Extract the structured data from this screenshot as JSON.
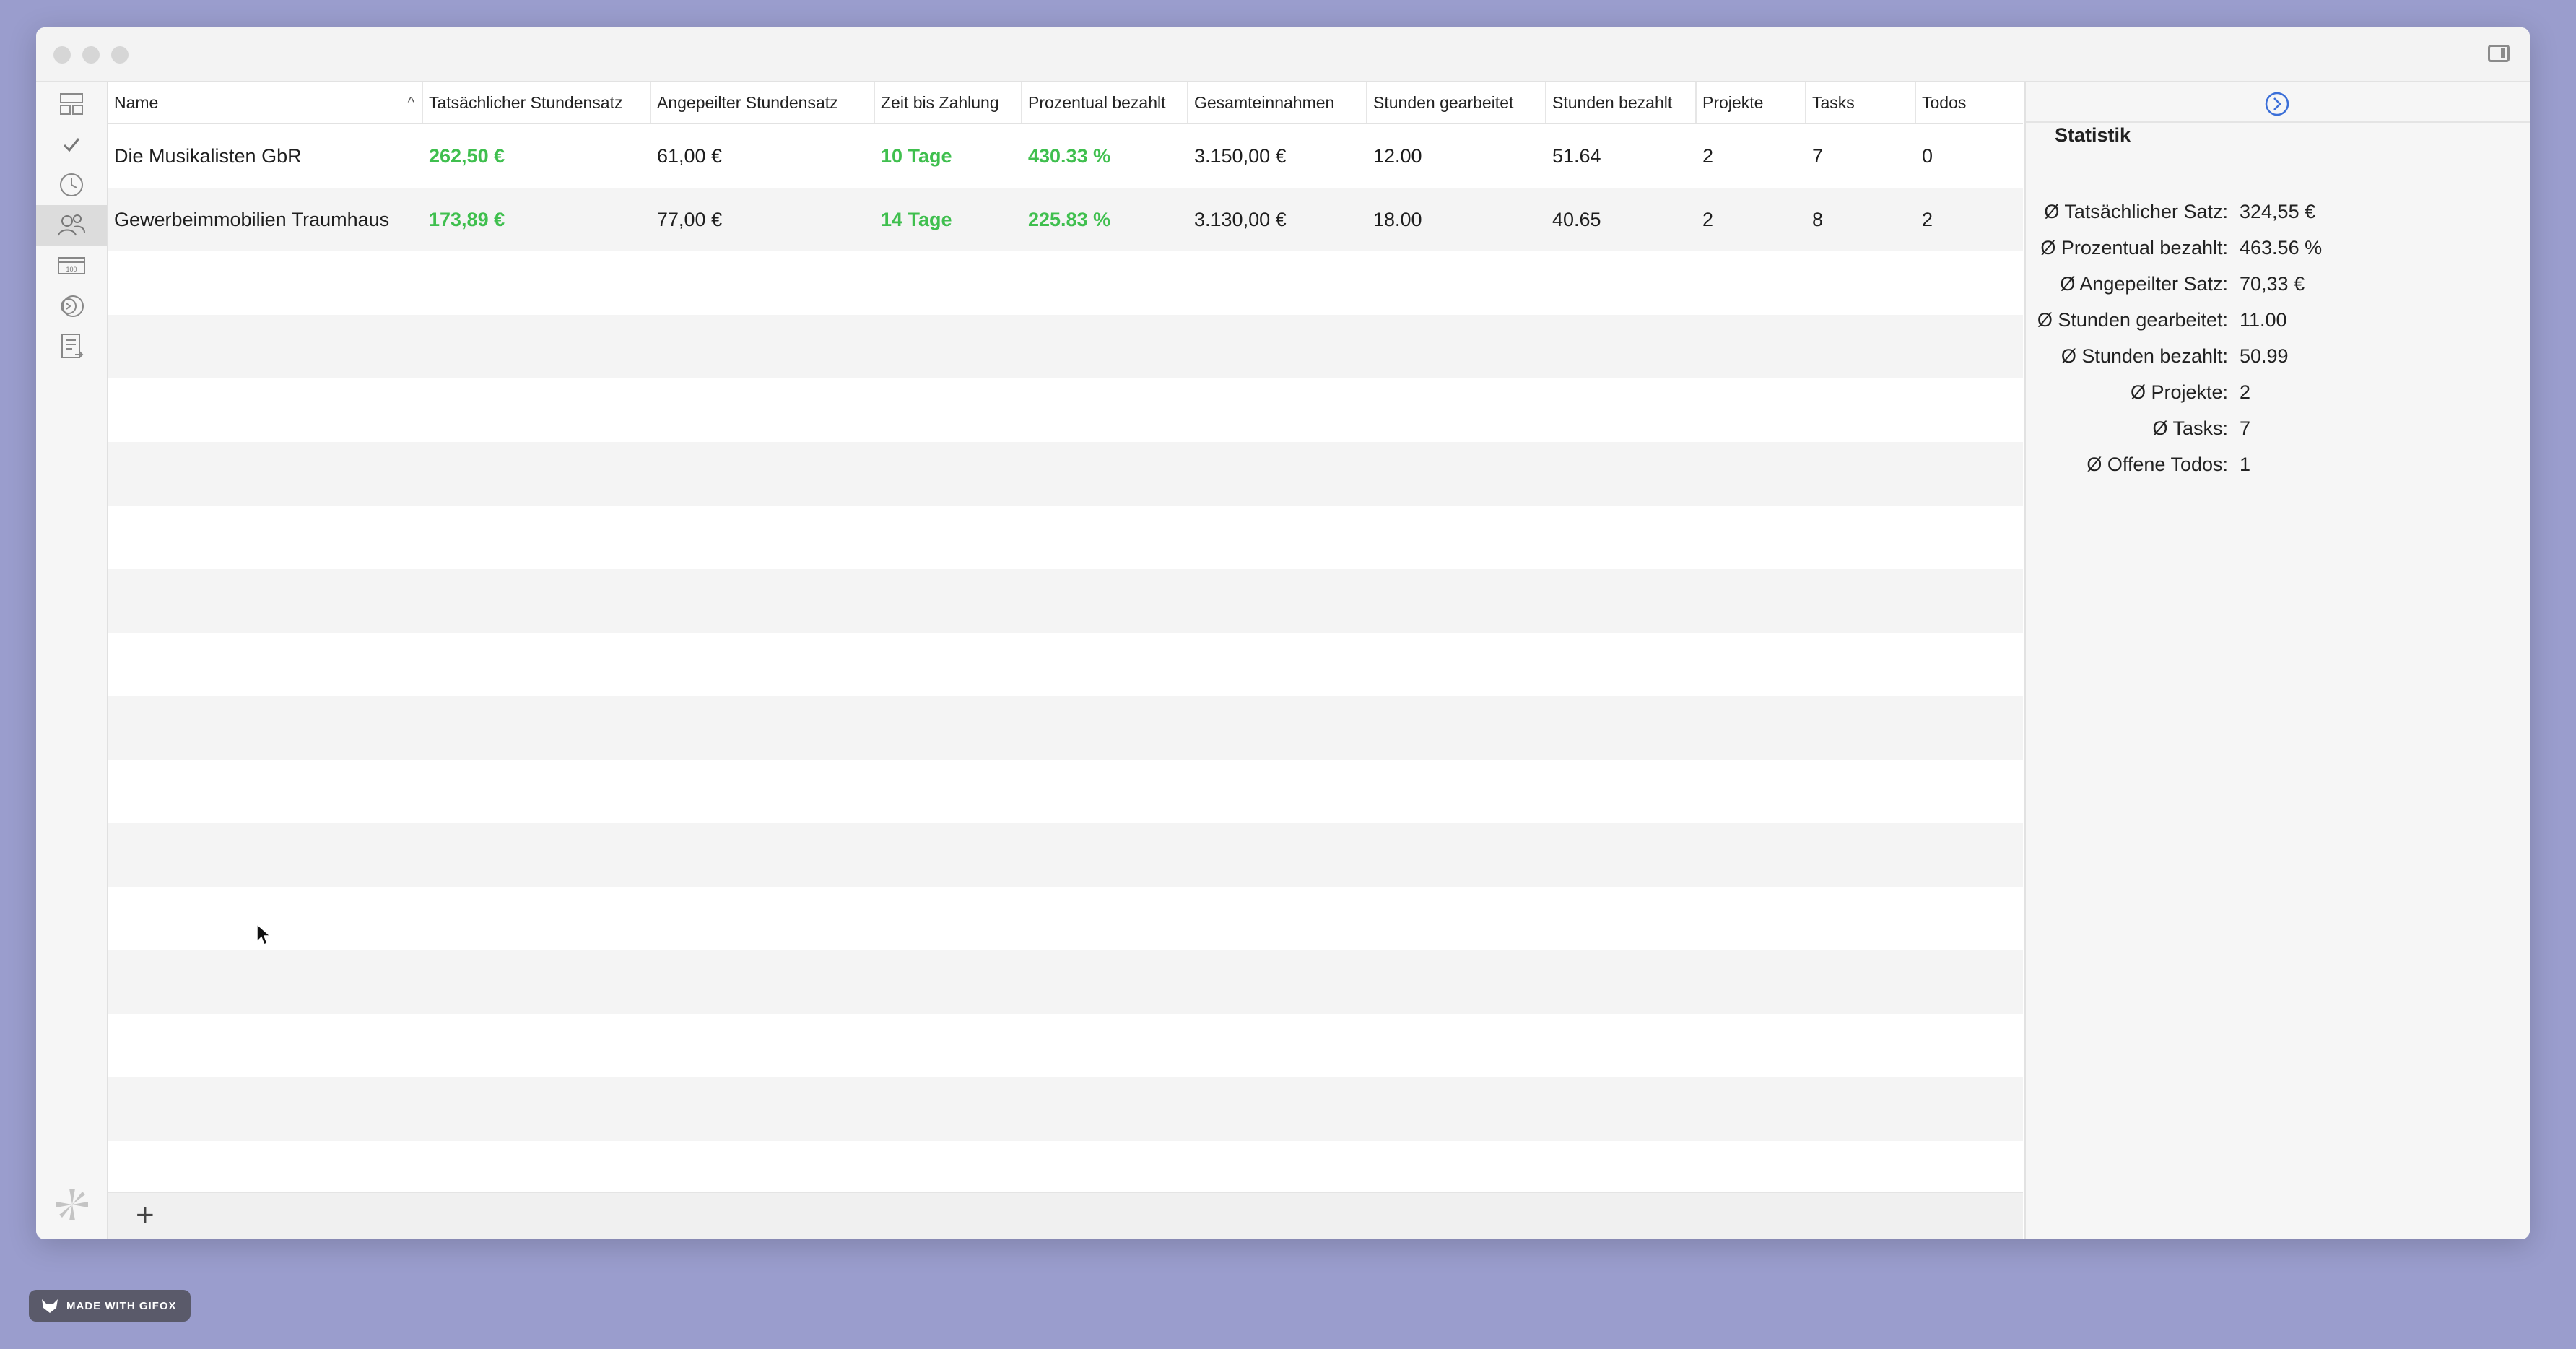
{
  "window": {
    "toolbar_icons": [
      "sidebar-toggle-icon"
    ]
  },
  "iconbar": {
    "items": [
      {
        "icon": "dashboard-icon",
        "active": false
      },
      {
        "icon": "checkmark-icon",
        "active": false
      },
      {
        "icon": "clock-icon",
        "active": false
      },
      {
        "icon": "clients-icon",
        "active": true
      },
      {
        "icon": "invoice-icon",
        "active": false
      },
      {
        "icon": "money-icon",
        "active": false
      },
      {
        "icon": "report-icon",
        "active": false
      }
    ]
  },
  "table": {
    "columns": [
      "Name",
      "Tatsächlicher Stundensatz",
      "Angepeilter Stundensatz",
      "Zeit bis Zahlung",
      "Prozentual bezahlt",
      "Gesamteinnahmen",
      "Stunden gearbeitet",
      "Stunden bezahlt",
      "Projekte",
      "Tasks",
      "Todos"
    ],
    "sort_indicator": "^",
    "rows": [
      [
        "Die Musikalisten GbR",
        "262,50 €",
        "61,00 €",
        "10 Tage",
        "430.33 %",
        "3.150,00 €",
        "12.00",
        "51.64",
        "2",
        "7",
        "0"
      ],
      [
        "Gewerbeimmobilien Traumhaus",
        "173,89 €",
        "77,00 €",
        "14 Tage",
        "225.83 %",
        "3.130,00 €",
        "18.00",
        "40.65",
        "2",
        "8",
        "2"
      ]
    ],
    "add_label": "+"
  },
  "stats": {
    "title": "Statistik",
    "items": [
      {
        "label": "Ø Tatsächlicher Satz:",
        "value": "324,55 €"
      },
      {
        "label": "Ø Prozentual bezahlt:",
        "value": "463.56 %"
      },
      {
        "label": "Ø Angepeilter Satz:",
        "value": "70,33 €"
      },
      {
        "label": "Ø Stunden gearbeitet:",
        "value": "11.00"
      },
      {
        "label": "Ø Stunden bezahlt:",
        "value": "50.99"
      },
      {
        "label": "Ø Projekte:",
        "value": "2"
      },
      {
        "label": "Ø Tasks:",
        "value": "7"
      },
      {
        "label": "Ø Offene Todos:",
        "value": "1"
      }
    ]
  },
  "badge": {
    "text": "MADE WITH GIFOX"
  },
  "colors": {
    "background": "#9a9dcd",
    "green": "#3fbf4e",
    "accent_blue": "#3b6fd8"
  }
}
